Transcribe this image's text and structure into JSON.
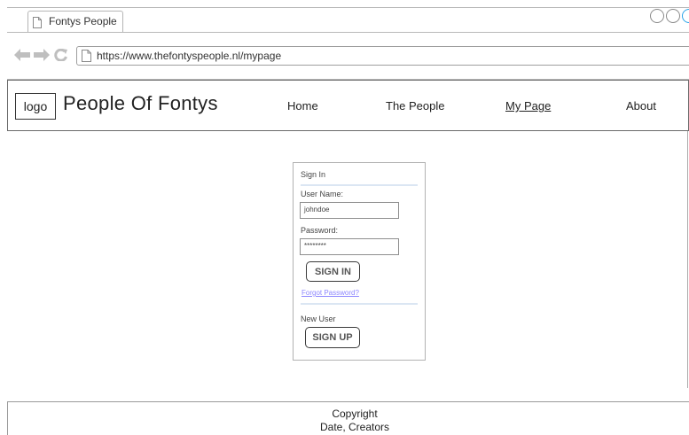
{
  "browser": {
    "tab_title": "Fontys People",
    "url": "https://www.thefontyspeople.nl/mypage",
    "nav_icons": [
      "back-arrow-icon",
      "forward-arrow-icon",
      "reload-icon",
      "page-icon"
    ],
    "window_buttons": [
      "minimize",
      "maximize",
      "close"
    ]
  },
  "site": {
    "logo_text": "logo",
    "title": "People Of Fontys",
    "nav": [
      "Home",
      "The People",
      "My Page",
      "About"
    ],
    "active_nav": "My Page"
  },
  "signin": {
    "heading": "Sign In",
    "username_label": "User Name:",
    "username_value": "johndoe",
    "password_label": "Password:",
    "password_value": "********",
    "signin_button": "SIGN IN",
    "forgot_link": "Forgot Password?",
    "new_user_label": "New User",
    "signup_button": "SIGN UP"
  },
  "footer": {
    "line1": "Copyright",
    "line2": "Date, Creators"
  },
  "colors": {
    "link": "#8d86ff",
    "divider": "#dbe6f3",
    "window_close_accent": "#2aa4e8"
  }
}
